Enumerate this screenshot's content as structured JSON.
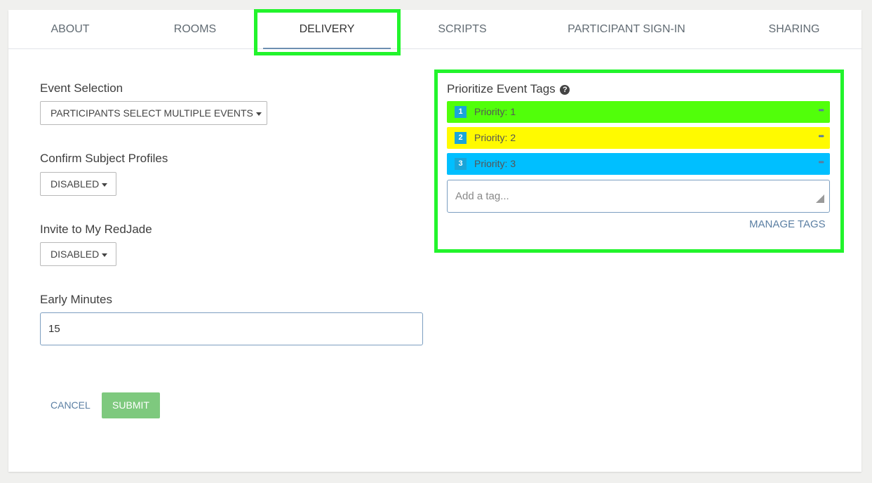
{
  "tabs": [
    {
      "label": "ABOUT"
    },
    {
      "label": "ROOMS"
    },
    {
      "label": "DELIVERY",
      "active": true
    },
    {
      "label": "SCRIPTS"
    },
    {
      "label": "PARTICIPANT SIGN-IN"
    },
    {
      "label": "SHARING"
    }
  ],
  "form": {
    "event_selection": {
      "label": "Event Selection",
      "value": "PARTICIPANTS SELECT MULTIPLE EVENTS"
    },
    "confirm_profiles": {
      "label": "Confirm Subject Profiles",
      "value": "DISABLED"
    },
    "invite": {
      "label": "Invite to My RedJade",
      "value": "DISABLED"
    },
    "early_minutes": {
      "label": "Early Minutes",
      "value": "15"
    },
    "cancel_label": "CANCEL",
    "submit_label": "SUBMIT"
  },
  "tags": {
    "title": "Prioritize Event Tags",
    "help_glyph": "?",
    "items": [
      {
        "num": "1",
        "label": "Priority: 1",
        "color": "#51ff0a"
      },
      {
        "num": "2",
        "label": "Priority: 2",
        "color": "#fffa00"
      },
      {
        "num": "3",
        "label": "Priority: 3",
        "color": "#00bfff"
      }
    ],
    "more_glyph": "•••",
    "add_placeholder": "Add a tag...",
    "manage_label": "MANAGE TAGS"
  },
  "colors": {
    "highlight": "#22f42c",
    "link": "#5b7fa3",
    "submit_bg": "#7ec97e",
    "tag_badge": "#1aa5d9"
  }
}
